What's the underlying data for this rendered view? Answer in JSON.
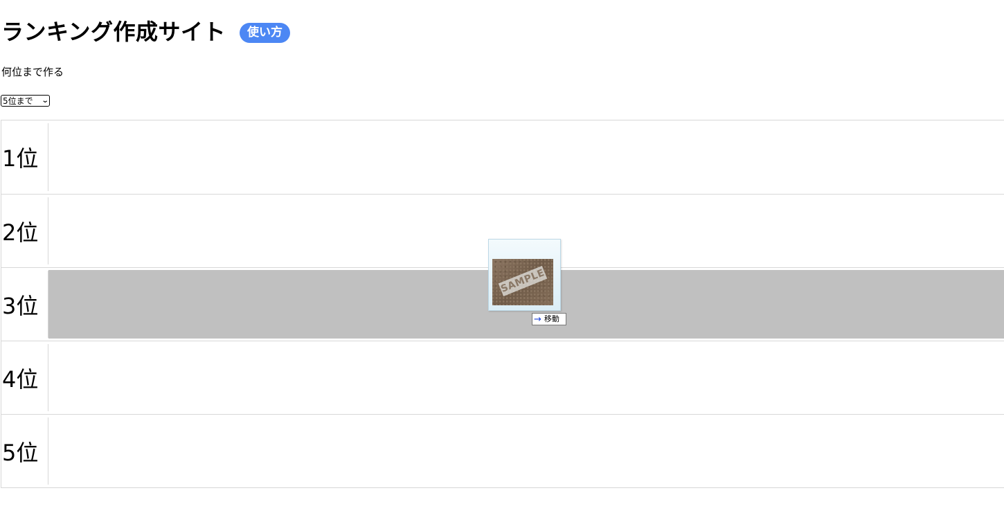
{
  "header": {
    "title": "ランキング作成サイト",
    "howto_label": "使い方"
  },
  "settings": {
    "count_label": "何位まで作る",
    "count_selected": "5位まで"
  },
  "ranks": [
    {
      "label": "1位",
      "highlighted": false
    },
    {
      "label": "2位",
      "highlighted": false
    },
    {
      "label": "3位",
      "highlighted": true
    },
    {
      "label": "4位",
      "highlighted": false
    },
    {
      "label": "5位",
      "highlighted": false
    }
  ],
  "drag": {
    "image_text": "SAMPLE",
    "tooltip_label": "移動",
    "tooltip_icon": "right-arrow-icon"
  },
  "colors": {
    "accent": "#4c87f4",
    "drop_highlight": "#c0c0c0",
    "border": "#d7d7d7"
  }
}
